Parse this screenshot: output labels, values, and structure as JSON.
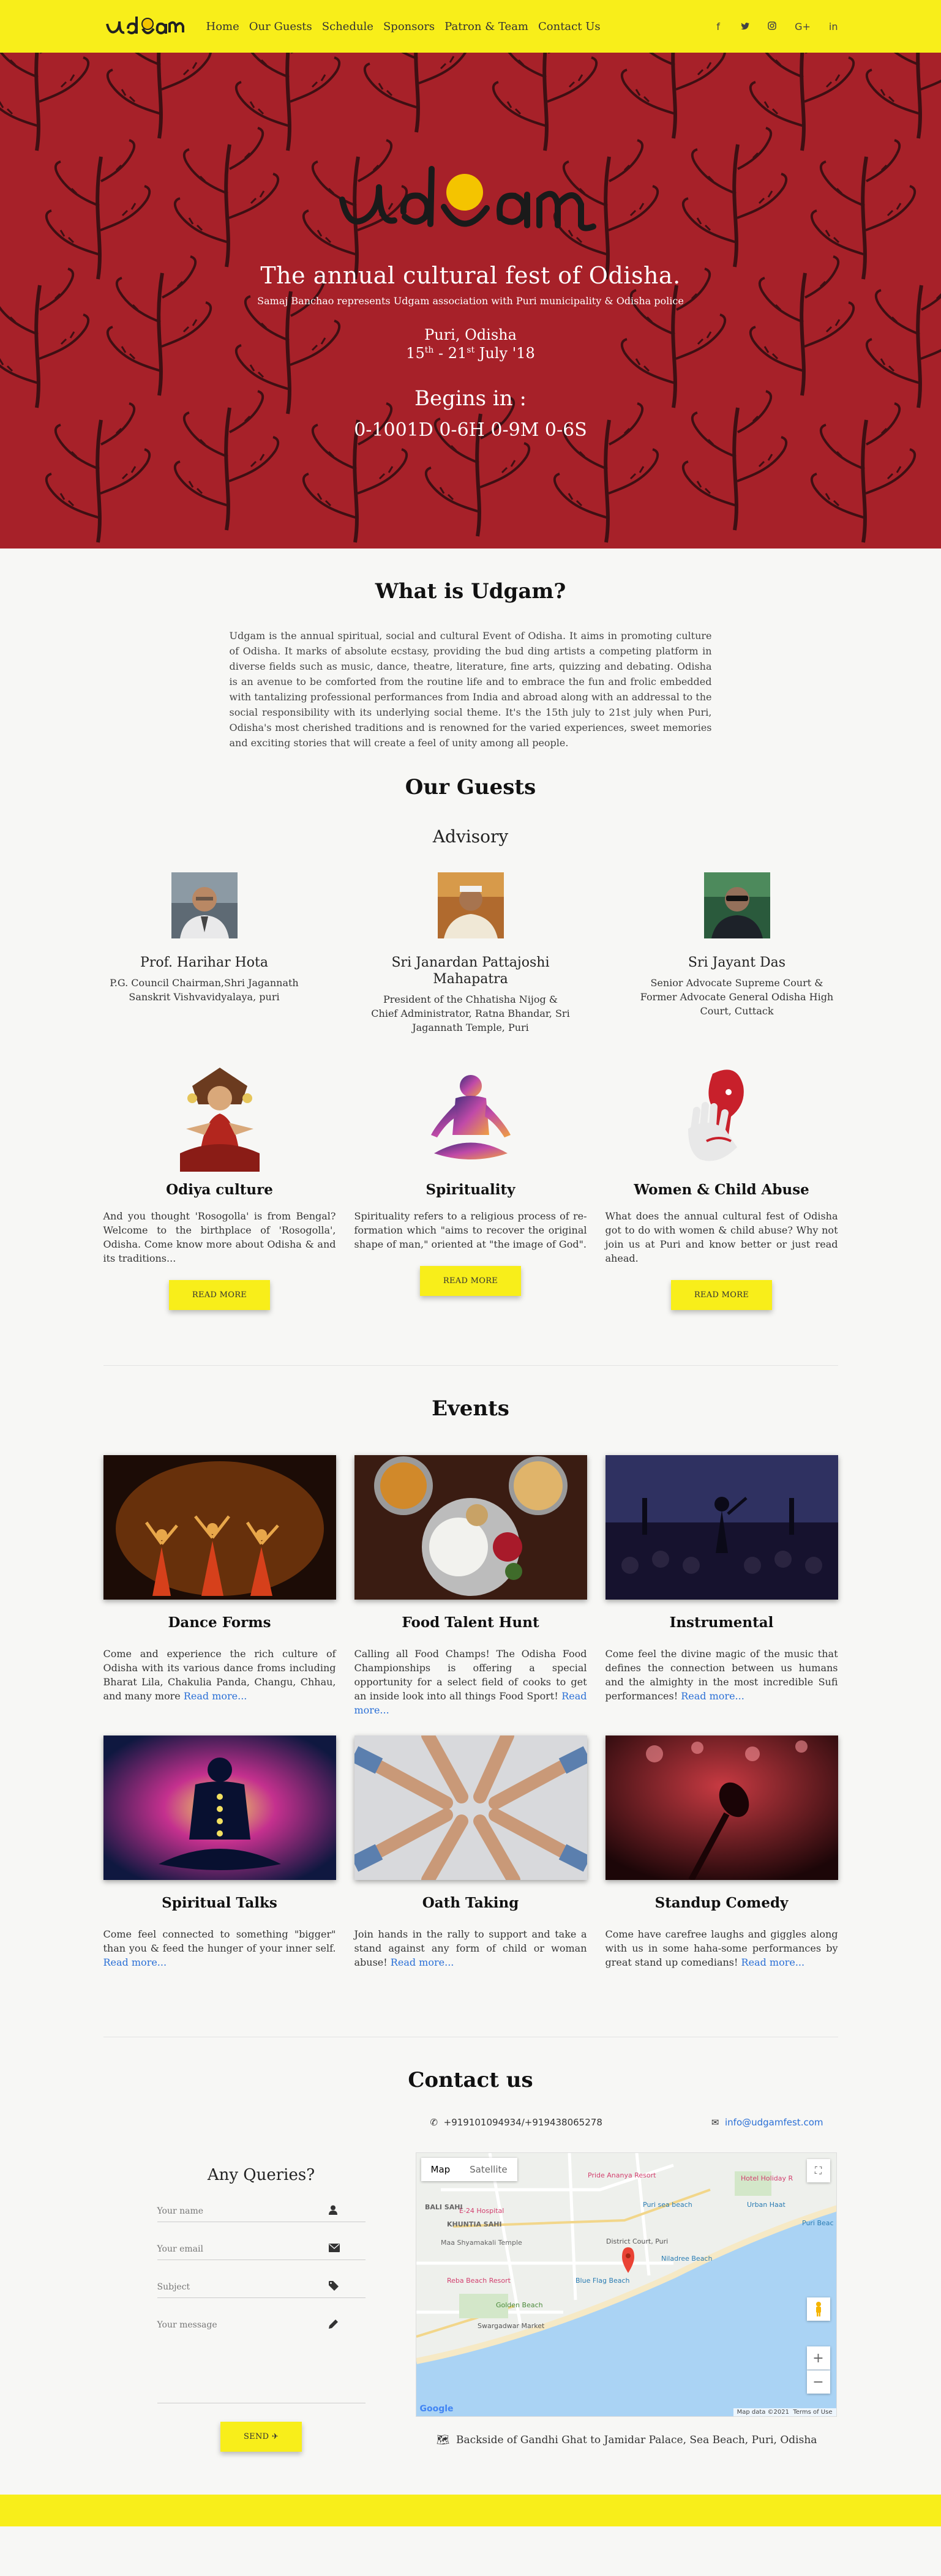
{
  "nav": {
    "logo_text": "udgam",
    "items": [
      "Home",
      "Our Guests",
      "Schedule",
      "Sponsors",
      "Patron & Team",
      "Contact Us"
    ],
    "social_icons": [
      "facebook-icon",
      "twitter-icon",
      "instagram-icon",
      "google-plus-icon",
      "linkedin-icon"
    ],
    "social_glyphs": [
      "f",
      "🐦",
      "◎",
      "G+",
      "in"
    ]
  },
  "hero": {
    "tagline": "The annual cultural fest of Odisha.",
    "sub": "Samaj Banchao represents Udgam association with Puri municipality & Odisha police",
    "place": "Puri, Odisha",
    "date_start": "15",
    "date_start_sup": "th",
    "date_mid": " - 21",
    "date_end_sup": "st",
    "date_tail": " July '18",
    "begins": "Begins in :",
    "countdown": "0-1001D 0-6H 0-9M 0-6S"
  },
  "about": {
    "title": "What is Udgam?",
    "body": "Udgam is the annual spiritual, social and cultural Event of Odisha. It aims in promoting culture of Odisha. It marks of absolute ecstasy, providing the bud ding artists a competing platform in diverse fields such as music, dance, theatre, literature, fine arts, quizzing and debating. Odisha is an avenue to be comforted from the routine life and to embrace the fun and frolic embedded with tantalizing professional performances from India and abroad along with an addressal to the social responsibility with its underlying social theme. It's the 15th july to 21st july when Puri, Odisha's most cherished traditions and is renowned for the varied experiences, sweet memories and exciting stories that will create a feel of unity among all people."
  },
  "guests": {
    "title": "Our Guests",
    "advisory": "Advisory",
    "people": [
      {
        "name": "Prof. Harihar Hota",
        "role": "P.G. Council Chairman,Shri Jagannath Sanskrit Vishvavidyalaya, puri"
      },
      {
        "name": "Sri Janardan Pattajoshi Mahapatra",
        "role": "President of the Chhatisha Nijog & Chief Administrator, Ratna Bhandar, Sri Jagannath Temple, Puri"
      },
      {
        "name": "Sri Jayant Das",
        "role": "Senior Advocate Supreme Court & Former Advocate General Odisha High Court, Cuttack"
      }
    ]
  },
  "causes": [
    {
      "title": "Odiya culture",
      "text": "And you thought 'Rosogolla' is from Bengal? Welcome to the birthplace of 'Rosogolla', Odisha. Come know more about Odisha & and its traditions...",
      "button": "READ MORE"
    },
    {
      "title": "Spirituality",
      "text": "Spirituality refers to a religious process of re-formation which \"aims to recover the original shape of man,\" oriented at \"the image of God\".",
      "button": "READ MORE"
    },
    {
      "title": "Women & Child Abuse",
      "text": "What does the annual cultural fest of Odisha got to do with women & child abuse? Why not join us at Puri and know better or just read ahead.",
      "button": "READ MORE"
    }
  ],
  "events": {
    "title": "Events",
    "read_more": "Read more...",
    "items": [
      {
        "title": "Dance Forms",
        "text": "Come and experience the rich culture of Odisha with its various dance froms including Bharat Lila, Chakulia Panda, Changu, Chhau, and many more"
      },
      {
        "title": "Food Talent Hunt",
        "text": "Calling all Food Champs! The Odisha Food Championships is offering a special opportunity for a select field of cooks to get an inside look into all things Food Sport!"
      },
      {
        "title": "Instrumental",
        "text": "Come feel the divine magic of the music that defines the connection between us humans and the almighty in the most incredible Sufi performances!"
      },
      {
        "title": "Spiritual Talks",
        "text": "Come feel connected to something \"bigger\" than you & feed the hunger of your inner self."
      },
      {
        "title": "Oath Taking",
        "text": "Join hands in the rally to support and take a stand against any form of child or woman abuse!"
      },
      {
        "title": "Standup Comedy",
        "text": "Come have carefree laughs and giggles along with us in some haha-some performances by great stand up comedians!"
      }
    ]
  },
  "contact": {
    "title": "Contact us",
    "phone": "+919101094934/+919438065278",
    "email": "info@udgamfest.com",
    "form_title": "Any Queries?",
    "fields": [
      "Your name",
      "Your email",
      "Subject",
      "Your message"
    ],
    "send": "SEND",
    "address": "Backside of Gandhi Ghat to Jamidar Palace, Sea Beach, Puri, Odisha",
    "map": {
      "tab_map": "Map",
      "tab_satellite": "Satellite",
      "labels": [
        "Pride Ananya Resort",
        "Hotel Holiday R",
        "E-24 Hospital",
        "BALI SAHI",
        "Puri sea beach",
        "Urban Haat",
        "KHUNTIA SAHI",
        "Puri Beac",
        "Maa Shyamakali Temple",
        "District Court, Puri",
        "Niladree Beach",
        "Reba Beach Resort",
        "Blue Flag Beach",
        "Golden Beach",
        "Swargadwar Market"
      ],
      "footer": "Map data ©2021",
      "terms": "Terms of Use",
      "google": "Google"
    }
  },
  "colors": {
    "brand_yellow": "#f8ee1a",
    "hero_red": "#a8212a",
    "link_blue": "#2a6fd6"
  }
}
